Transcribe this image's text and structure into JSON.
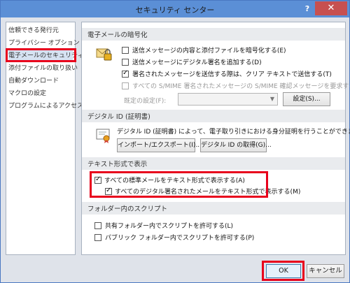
{
  "window": {
    "title": "セキュリティ センター",
    "help": "?",
    "close": "✕"
  },
  "sidebar": {
    "items": [
      {
        "label": "信頼できる発行元"
      },
      {
        "label": "プライバシー オプション"
      },
      {
        "label": "電子メールのセキュリティ"
      },
      {
        "label": "添付ファイルの取り扱い"
      },
      {
        "label": "自動ダウンロード"
      },
      {
        "label": "マクロの設定"
      },
      {
        "label": "プログラムによるアクセス"
      }
    ]
  },
  "encrypted": {
    "heading": "電子メールの暗号化",
    "options": [
      {
        "label": "送信メッセージの内容と添付ファイルを暗号化する(E)",
        "checked": false
      },
      {
        "label": "送信メッセージにデジタル署名を追加する(D)",
        "checked": false
      },
      {
        "label": "署名されたメッセージを送信する際は、クリア テキストで送信する(T)",
        "checked": true
      },
      {
        "label": "すべての S/MIME 署名されたメッセージの S/MIME 確認メッセージを要求する(R)",
        "checked": false
      }
    ],
    "default_label": "既定の設定(F):",
    "settings_button": "設定(S)..."
  },
  "digital_id": {
    "heading": "デジタル ID (証明書)",
    "description": "デジタル ID (証明書) によって、電子取り引きにおける身分証明を行うことができます。",
    "import_button": "インポート/エクスポート(I)...",
    "get_button": "デジタル ID の取得(G)..."
  },
  "plain_text": {
    "heading": "テキスト形式で表示",
    "opt1": "すべての標準メールをテキスト形式で表示する(A)",
    "opt2": "すべてのデジタル署名されたメールをテキスト形式で表示する(M)"
  },
  "folder_script": {
    "heading": "フォルダー内のスクリプト",
    "opt1": "共有フォルダー内でスクリプトを許可する(L)",
    "opt2": "パブリック フォルダー内でスクリプトを許可する(P)"
  },
  "footer": {
    "ok": "OK",
    "cancel": "キャンセル"
  },
  "colors": {
    "highlight_box": "#e8001c",
    "titlebar": "#5b8fd6",
    "close": "#c75050"
  }
}
